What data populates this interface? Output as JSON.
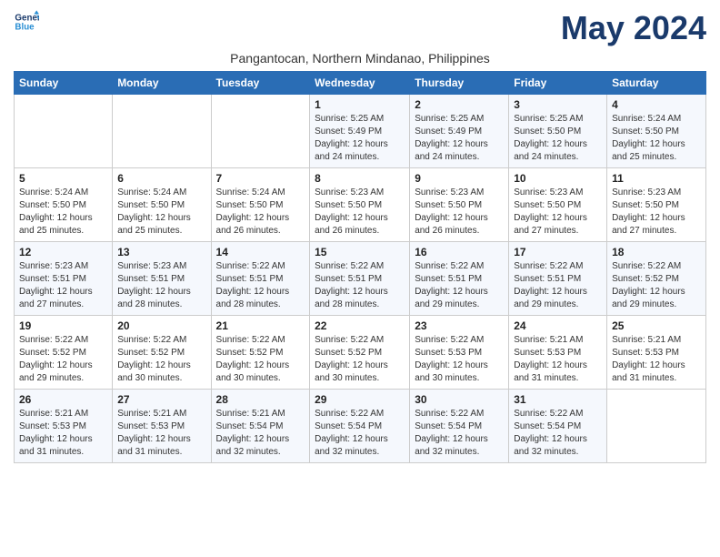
{
  "logo": {
    "text_general": "General",
    "text_blue": "Blue"
  },
  "header": {
    "month_title": "May 2024",
    "subtitle": "Pangantocan, Northern Mindanao, Philippines"
  },
  "days_of_week": [
    "Sunday",
    "Monday",
    "Tuesday",
    "Wednesday",
    "Thursday",
    "Friday",
    "Saturday"
  ],
  "weeks": [
    [
      {
        "day": "",
        "info": ""
      },
      {
        "day": "",
        "info": ""
      },
      {
        "day": "",
        "info": ""
      },
      {
        "day": "1",
        "info": "Sunrise: 5:25 AM\nSunset: 5:49 PM\nDaylight: 12 hours and 24 minutes."
      },
      {
        "day": "2",
        "info": "Sunrise: 5:25 AM\nSunset: 5:49 PM\nDaylight: 12 hours and 24 minutes."
      },
      {
        "day": "3",
        "info": "Sunrise: 5:25 AM\nSunset: 5:50 PM\nDaylight: 12 hours and 24 minutes."
      },
      {
        "day": "4",
        "info": "Sunrise: 5:24 AM\nSunset: 5:50 PM\nDaylight: 12 hours and 25 minutes."
      }
    ],
    [
      {
        "day": "5",
        "info": "Sunrise: 5:24 AM\nSunset: 5:50 PM\nDaylight: 12 hours and 25 minutes."
      },
      {
        "day": "6",
        "info": "Sunrise: 5:24 AM\nSunset: 5:50 PM\nDaylight: 12 hours and 25 minutes."
      },
      {
        "day": "7",
        "info": "Sunrise: 5:24 AM\nSunset: 5:50 PM\nDaylight: 12 hours and 26 minutes."
      },
      {
        "day": "8",
        "info": "Sunrise: 5:23 AM\nSunset: 5:50 PM\nDaylight: 12 hours and 26 minutes."
      },
      {
        "day": "9",
        "info": "Sunrise: 5:23 AM\nSunset: 5:50 PM\nDaylight: 12 hours and 26 minutes."
      },
      {
        "day": "10",
        "info": "Sunrise: 5:23 AM\nSunset: 5:50 PM\nDaylight: 12 hours and 27 minutes."
      },
      {
        "day": "11",
        "info": "Sunrise: 5:23 AM\nSunset: 5:50 PM\nDaylight: 12 hours and 27 minutes."
      }
    ],
    [
      {
        "day": "12",
        "info": "Sunrise: 5:23 AM\nSunset: 5:51 PM\nDaylight: 12 hours and 27 minutes."
      },
      {
        "day": "13",
        "info": "Sunrise: 5:23 AM\nSunset: 5:51 PM\nDaylight: 12 hours and 28 minutes."
      },
      {
        "day": "14",
        "info": "Sunrise: 5:22 AM\nSunset: 5:51 PM\nDaylight: 12 hours and 28 minutes."
      },
      {
        "day": "15",
        "info": "Sunrise: 5:22 AM\nSunset: 5:51 PM\nDaylight: 12 hours and 28 minutes."
      },
      {
        "day": "16",
        "info": "Sunrise: 5:22 AM\nSunset: 5:51 PM\nDaylight: 12 hours and 29 minutes."
      },
      {
        "day": "17",
        "info": "Sunrise: 5:22 AM\nSunset: 5:51 PM\nDaylight: 12 hours and 29 minutes."
      },
      {
        "day": "18",
        "info": "Sunrise: 5:22 AM\nSunset: 5:52 PM\nDaylight: 12 hours and 29 minutes."
      }
    ],
    [
      {
        "day": "19",
        "info": "Sunrise: 5:22 AM\nSunset: 5:52 PM\nDaylight: 12 hours and 29 minutes."
      },
      {
        "day": "20",
        "info": "Sunrise: 5:22 AM\nSunset: 5:52 PM\nDaylight: 12 hours and 30 minutes."
      },
      {
        "day": "21",
        "info": "Sunrise: 5:22 AM\nSunset: 5:52 PM\nDaylight: 12 hours and 30 minutes."
      },
      {
        "day": "22",
        "info": "Sunrise: 5:22 AM\nSunset: 5:52 PM\nDaylight: 12 hours and 30 minutes."
      },
      {
        "day": "23",
        "info": "Sunrise: 5:22 AM\nSunset: 5:53 PM\nDaylight: 12 hours and 30 minutes."
      },
      {
        "day": "24",
        "info": "Sunrise: 5:21 AM\nSunset: 5:53 PM\nDaylight: 12 hours and 31 minutes."
      },
      {
        "day": "25",
        "info": "Sunrise: 5:21 AM\nSunset: 5:53 PM\nDaylight: 12 hours and 31 minutes."
      }
    ],
    [
      {
        "day": "26",
        "info": "Sunrise: 5:21 AM\nSunset: 5:53 PM\nDaylight: 12 hours and 31 minutes."
      },
      {
        "day": "27",
        "info": "Sunrise: 5:21 AM\nSunset: 5:53 PM\nDaylight: 12 hours and 31 minutes."
      },
      {
        "day": "28",
        "info": "Sunrise: 5:21 AM\nSunset: 5:54 PM\nDaylight: 12 hours and 32 minutes."
      },
      {
        "day": "29",
        "info": "Sunrise: 5:22 AM\nSunset: 5:54 PM\nDaylight: 12 hours and 32 minutes."
      },
      {
        "day": "30",
        "info": "Sunrise: 5:22 AM\nSunset: 5:54 PM\nDaylight: 12 hours and 32 minutes."
      },
      {
        "day": "31",
        "info": "Sunrise: 5:22 AM\nSunset: 5:54 PM\nDaylight: 12 hours and 32 minutes."
      },
      {
        "day": "",
        "info": ""
      }
    ]
  ]
}
